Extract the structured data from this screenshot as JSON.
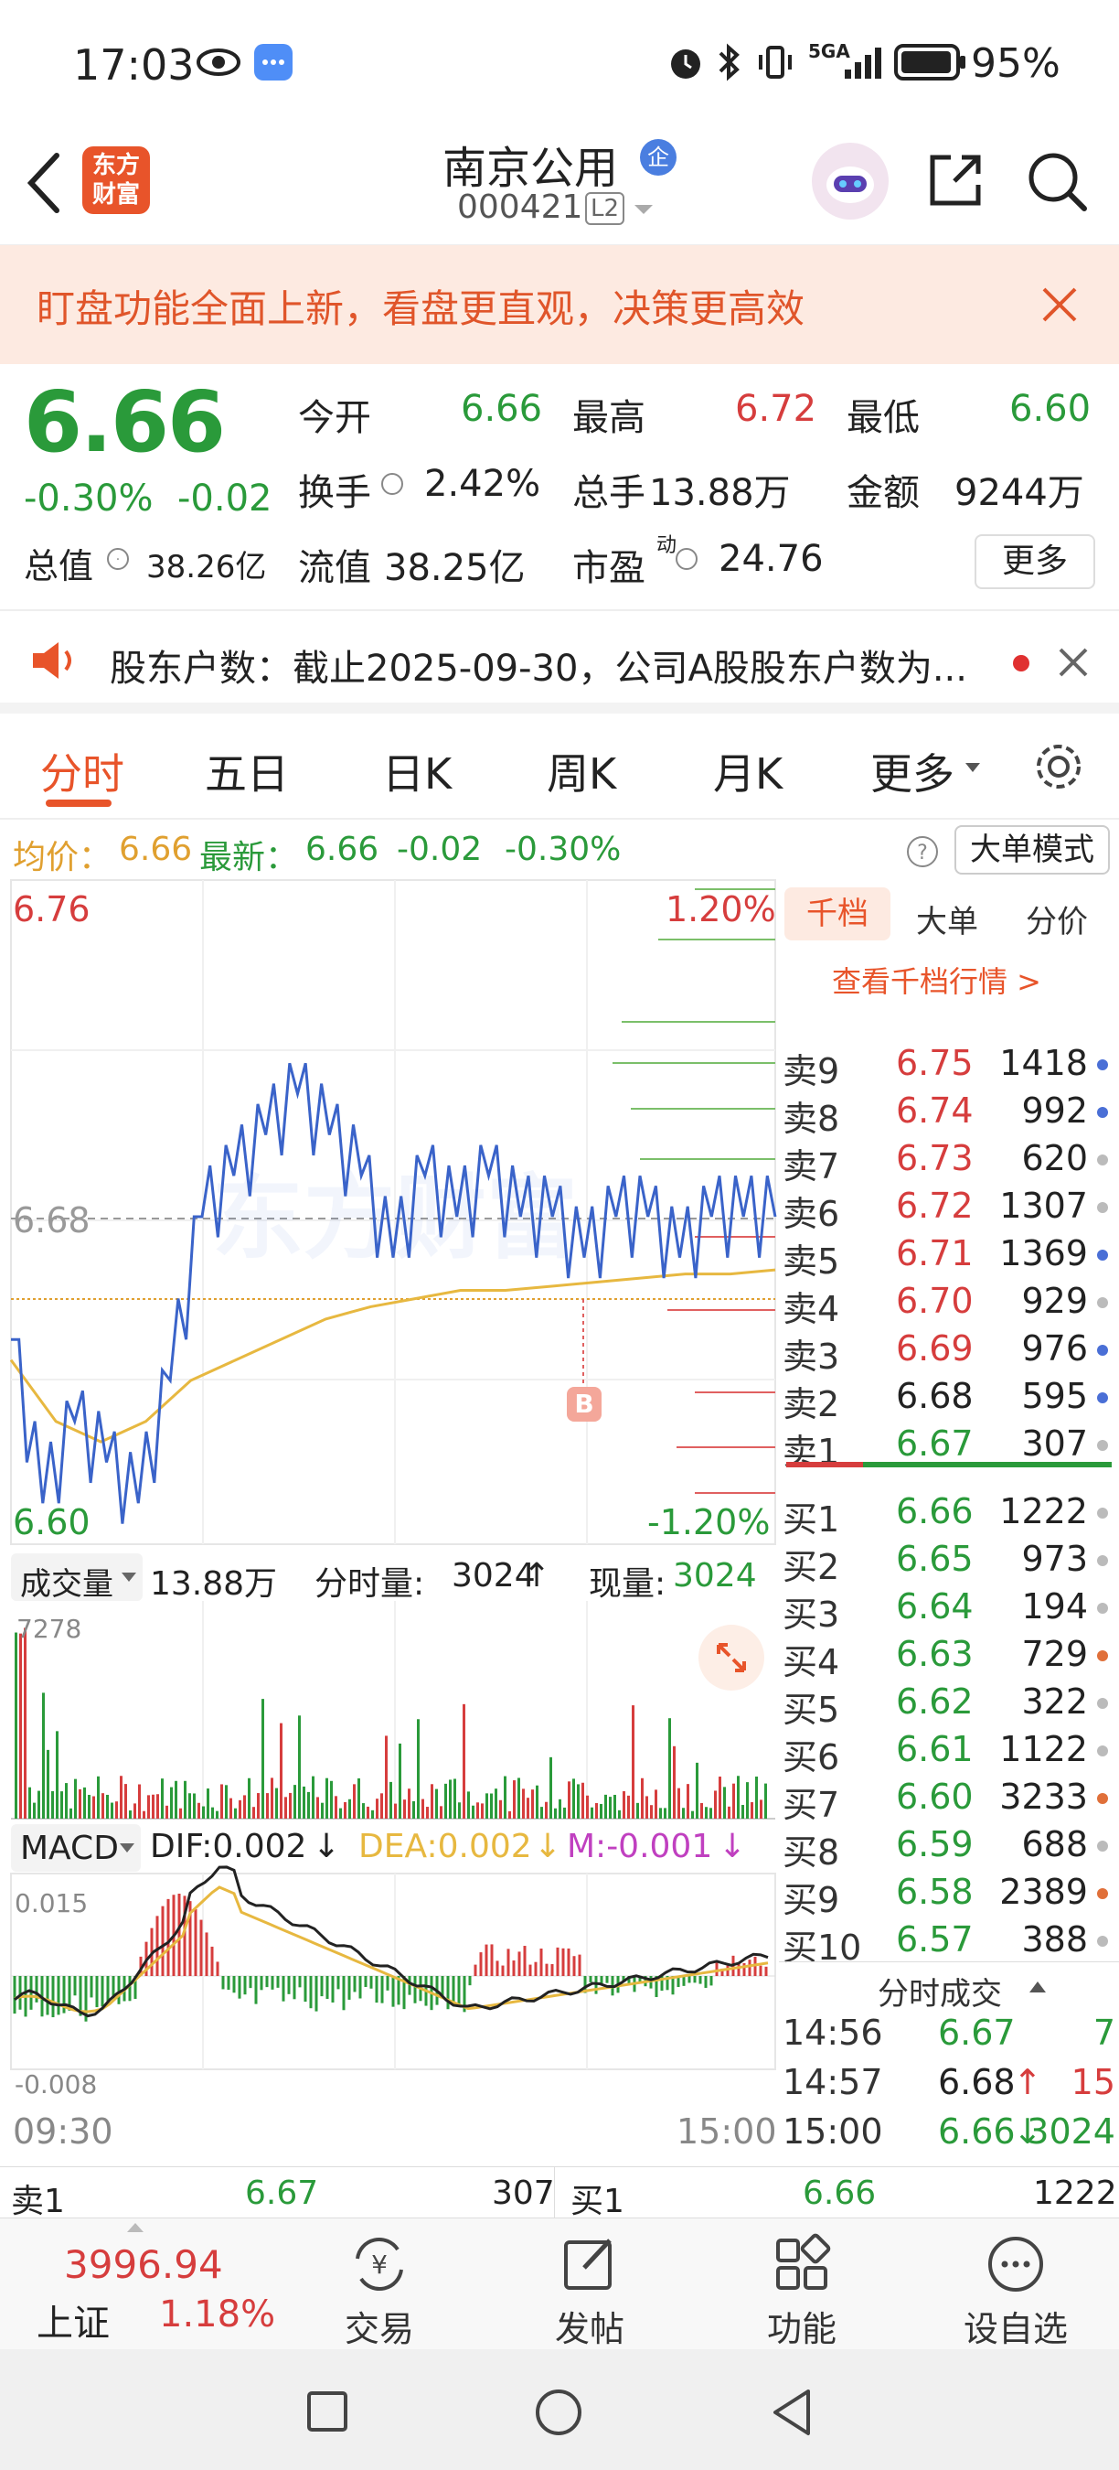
{
  "status_bar": {
    "time": "17:03",
    "network": "5GA",
    "battery": "95%"
  },
  "header": {
    "brand_line1": "东方",
    "brand_line2": "财富",
    "stock_name": "南京公用",
    "badge": "企",
    "stock_code": "000421",
    "level": "L2"
  },
  "banner": {
    "text": "盯盘功能全面上新，看盘更直观，决策更高效"
  },
  "quote": {
    "price": "6.66",
    "change_pct": "-0.30%",
    "change": "-0.02",
    "open_label": "今开",
    "open": "6.66",
    "high_label": "最高",
    "high": "6.72",
    "low_label": "最低",
    "low": "6.60",
    "turnover_label": "换手",
    "turnover": "2.42%",
    "volume_label": "总手",
    "volume": "13.88万",
    "amount_label": "金额",
    "amount": "9244万",
    "mcap_label": "总值",
    "mcap": "38.26亿",
    "float_label": "流值",
    "float_mcap": "38.25亿",
    "pe_label": "市盈",
    "pe_sup": "动",
    "pe": "24.76",
    "more_button": "更多"
  },
  "notice": {
    "text": "股东户数：截止2025-09-30，公司A股股东户数为..."
  },
  "tabs": [
    "分时",
    "五日",
    "日K",
    "周K",
    "月K",
    "更多"
  ],
  "info_row": {
    "avg_label": "均价：",
    "avg": "6.66",
    "latest_label": "最新：",
    "latest": "6.66",
    "chg": "-0.02",
    "pct": "-0.30%",
    "mode_button": "大单模式"
  },
  "chart": {
    "y_top": "6.76",
    "y_mid": "6.68",
    "y_bottom": "6.60",
    "pct_top": "1.20%",
    "pct_bottom": "-1.20%",
    "marker": "B",
    "watermark": "东方财富",
    "vol_label": "成交量",
    "vol_total": "13.88万",
    "vol_fen_label": "分时量:",
    "vol_fen": "3024",
    "vol_now_label": "现量:",
    "vol_now": "3024",
    "vol_max": "7278",
    "macd_label": "MACD",
    "dif": "DIF:0.002",
    "dea": "DEA:0.002",
    "m": "M:-0.001",
    "macd_top": "0.015",
    "macd_bottom": "-0.008",
    "time_start": "09:30",
    "time_end": "15:00"
  },
  "chart_data": {
    "type": "line",
    "title": "",
    "x": [
      "09:30",
      "15:00"
    ],
    "series": [
      {
        "name": "",
        "values": [
          6.65,
          6.61,
          6.63,
          6.62,
          6.61,
          6.64,
          6.68,
          6.69,
          6.7,
          6.71,
          6.7,
          6.69,
          6.67,
          6.69,
          6.68,
          6.69,
          6.68,
          6.68,
          6.67,
          6.68,
          6.68,
          6.67,
          6.68,
          6.68,
          6.68
        ]
      },
      {
        "name": "",
        "values": [
          6.645,
          6.63,
          6.625,
          6.63,
          6.64,
          6.645,
          6.65,
          6.655,
          6.658,
          6.66,
          6.662,
          6.662,
          6.663,
          6.664,
          6.665,
          6.666,
          6.666,
          6.667
        ]
      }
    ],
    "ylim": [
      6.6,
      6.76
    ]
  },
  "book": {
    "tabs": [
      "千档",
      "大单",
      "分价"
    ],
    "link": "查看千档行情 >",
    "sells": [
      {
        "label": "卖9",
        "price": "6.75",
        "vol": "1418",
        "dot": "#4a6fd6"
      },
      {
        "label": "卖8",
        "price": "6.74",
        "vol": "992",
        "dot": "#4a6fd6"
      },
      {
        "label": "卖7",
        "price": "6.73",
        "vol": "620",
        "dot": "#bbbbbb"
      },
      {
        "label": "卖6",
        "price": "6.72",
        "vol": "1307",
        "dot": "#bbbbbb"
      },
      {
        "label": "卖5",
        "price": "6.71",
        "vol": "1369",
        "dot": "#4a6fd6"
      },
      {
        "label": "卖4",
        "price": "6.70",
        "vol": "929",
        "dot": "#bbbbbb"
      },
      {
        "label": "卖3",
        "price": "6.69",
        "vol": "976",
        "dot": "#4a6fd6"
      },
      {
        "label": "卖2",
        "price": "6.68",
        "vol": "595",
        "dot": "#4a6fd6"
      },
      {
        "label": "卖1",
        "price": "6.67",
        "vol": "307",
        "dot": "#bbbbbb"
      }
    ],
    "buys": [
      {
        "label": "买1",
        "price": "6.66",
        "vol": "1222",
        "dot": "#bbbbbb"
      },
      {
        "label": "买2",
        "price": "6.65",
        "vol": "973",
        "dot": "#bbbbbb"
      },
      {
        "label": "买3",
        "price": "6.64",
        "vol": "194",
        "dot": "#bbbbbb"
      },
      {
        "label": "买4",
        "price": "6.63",
        "vol": "729",
        "dot": "#e0703a"
      },
      {
        "label": "买5",
        "price": "6.62",
        "vol": "322",
        "dot": "#bbbbbb"
      },
      {
        "label": "买6",
        "price": "6.61",
        "vol": "1122",
        "dot": "#bbbbbb"
      },
      {
        "label": "买7",
        "price": "6.60",
        "vol": "3233",
        "dot": "#e0703a"
      },
      {
        "label": "买8",
        "price": "6.59",
        "vol": "688",
        "dot": "#bbbbbb"
      },
      {
        "label": "买9",
        "price": "6.58",
        "vol": "2389",
        "dot": "#e0703a"
      },
      {
        "label": "买10",
        "price": "6.57",
        "vol": "388",
        "dot": "#bbbbbb"
      }
    ],
    "trades_title": "分时成交",
    "trades": [
      {
        "time": "14:56",
        "price": "6.67",
        "arrow": "",
        "vol": "7"
      },
      {
        "time": "14:57",
        "price": "6.68",
        "arrow": "↑",
        "vol": "15"
      },
      {
        "time": "15:00",
        "price": "6.66",
        "arrow": "↓",
        "vol": "3024"
      }
    ]
  },
  "bottom_quote": {
    "sell_label": "卖1",
    "sell_price": "6.67",
    "sell_vol": "307",
    "buy_label": "买1",
    "buy_price": "6.66",
    "buy_vol": "1222"
  },
  "bottom_bar": {
    "index_value": "3996.94",
    "index_name": "上证",
    "index_pct": "1.18%",
    "items": [
      "交易",
      "发帖",
      "功能",
      "设自选"
    ]
  }
}
